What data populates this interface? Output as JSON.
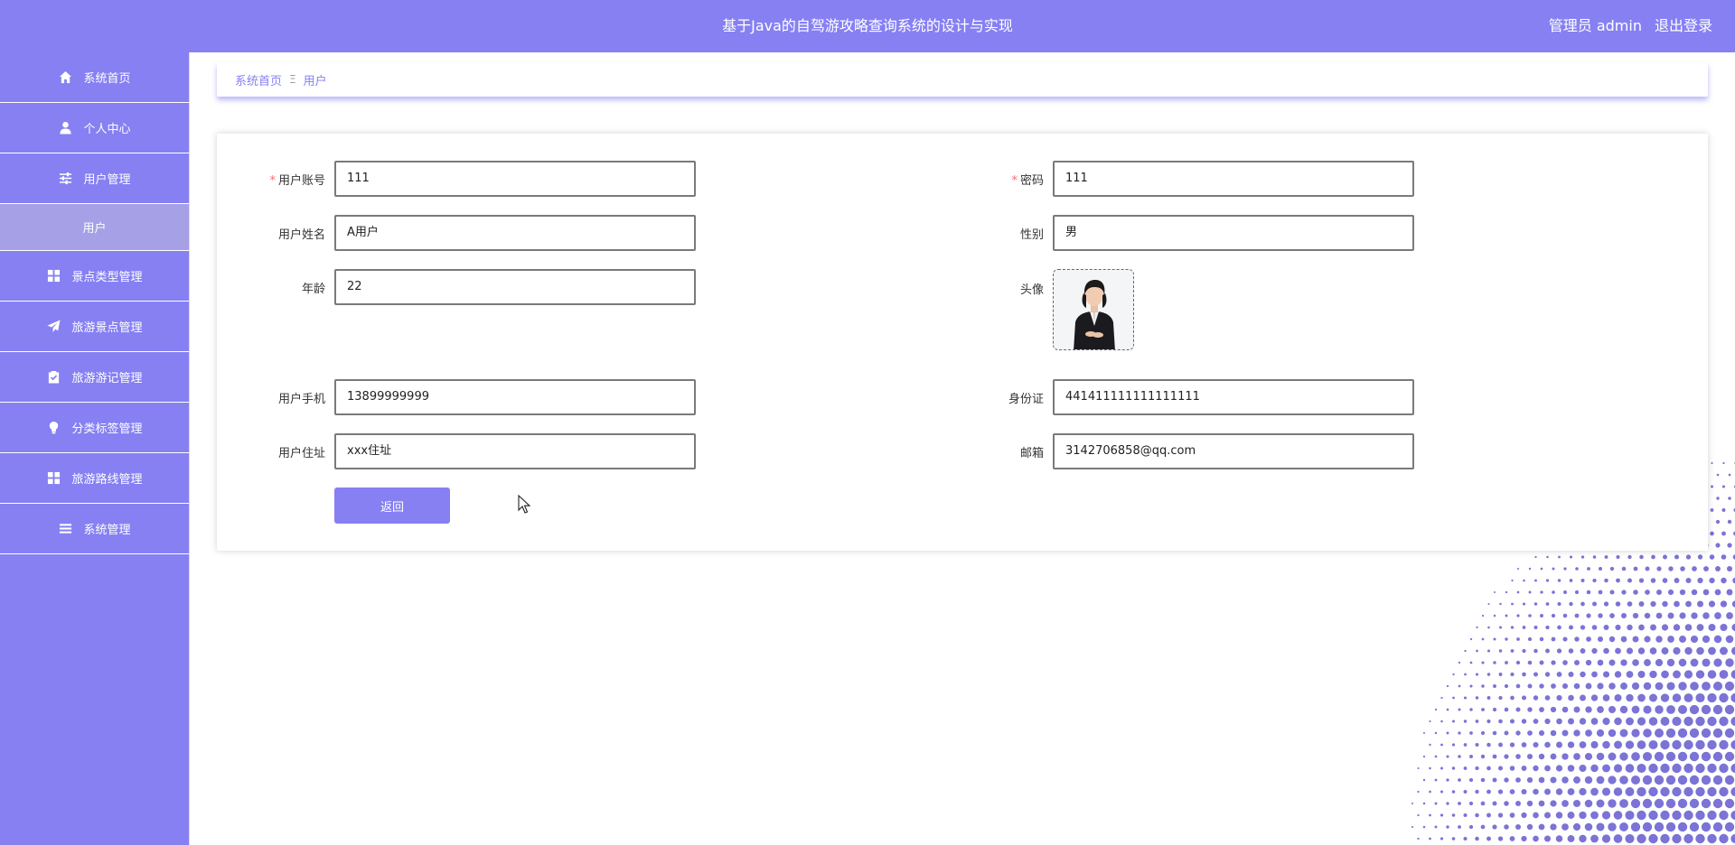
{
  "header": {
    "title": "基于Java的自驾游攻略查询系统的设计与实现",
    "user": "管理员 admin",
    "logout": "退出登录"
  },
  "sidebar": {
    "items": [
      {
        "label": "系统首页",
        "icon": "home-icon"
      },
      {
        "label": "个人中心",
        "icon": "user-icon"
      },
      {
        "label": "用户管理",
        "icon": "sliders-icon"
      },
      {
        "label": "用户",
        "icon": ""
      },
      {
        "label": "景点类型管理",
        "icon": "grid-icon"
      },
      {
        "label": "旅游景点管理",
        "icon": "send-icon"
      },
      {
        "label": "旅游游记管理",
        "icon": "clipboard-icon"
      },
      {
        "label": "分类标签管理",
        "icon": "bulb-icon"
      },
      {
        "label": "旅游路线管理",
        "icon": "grid-icon"
      },
      {
        "label": "系统管理",
        "icon": "menu-icon"
      }
    ]
  },
  "breadcrumb": {
    "home": "系统首页",
    "separator": "Ξ",
    "current": "用户"
  },
  "form": {
    "account": {
      "label": "用户账号",
      "value": "111",
      "required": true
    },
    "password": {
      "label": "密码",
      "value": "111",
      "required": true
    },
    "name": {
      "label": "用户姓名",
      "value": "A用户"
    },
    "gender": {
      "label": "性别",
      "value": "男"
    },
    "age": {
      "label": "年龄",
      "value": "22"
    },
    "avatar": {
      "label": "头像"
    },
    "phone": {
      "label": "用户手机",
      "value": "13899999999"
    },
    "idcard": {
      "label": "身份证",
      "value": "441411111111111111"
    },
    "address": {
      "label": "用户住址",
      "value": "xxx住址"
    },
    "email": {
      "label": "邮箱",
      "value": "3142706858@qq.com"
    },
    "back_label": "返回"
  },
  "colors": {
    "accent": "#8680f3",
    "submenu_active": "#a6a0e6",
    "required": "#f56c6c"
  }
}
